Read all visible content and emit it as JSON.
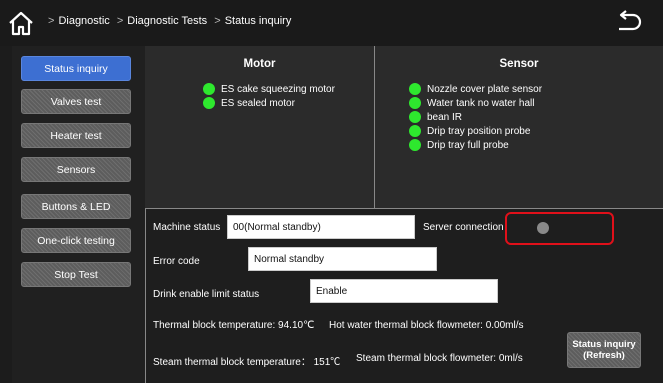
{
  "header": {
    "breadcrumbs": [
      "Diagnostic",
      "Diagnostic Tests",
      "Status inquiry"
    ]
  },
  "sidebar": {
    "items": [
      {
        "label": "Status inquiry",
        "active": true
      },
      {
        "label": "Valves test"
      },
      {
        "label": "Heater test"
      },
      {
        "label": "Sensors"
      },
      {
        "label": "Buttons & LED"
      },
      {
        "label": "One-click testing"
      },
      {
        "label": "Stop Test"
      }
    ]
  },
  "motor": {
    "title": "Motor",
    "items": [
      "ES cake squeezing motor",
      "ES sealed motor"
    ]
  },
  "sensor": {
    "title": "Sensor",
    "items": [
      "Nozzle cover plate sensor",
      "Water tank no water hall",
      "bean IR",
      "Drip tray position probe",
      "Drip tray full probe"
    ]
  },
  "status": {
    "machine_status_label": "Machine status",
    "machine_status_value": "00(Normal standby)",
    "server_connection_label": "Server connection",
    "error_code_label": "Error code",
    "error_code_value": "Normal standby",
    "drink_limit_label": "Drink enable limit status",
    "drink_limit_value": "Enable",
    "thermal_block_text": "Thermal block temperature:  94.10℃",
    "hot_water_flow_text": "Hot water thermal block flowmeter:   0.00ml/s",
    "steam_block_text": "Steam thermal block temperature：   151℃",
    "steam_flow_text": "Steam thermal block flowmeter:   0ml/s",
    "refresh_line1": "Status inquiry",
    "refresh_line2": "(Refresh)"
  },
  "colors": {
    "active_tab": "#3d6fd2",
    "led_on": "#2ee82e",
    "led_off": "#8a8a8a",
    "highlight": "#e0101a"
  },
  "icons": {
    "home": "home-icon",
    "back": "back-arrow-icon"
  }
}
